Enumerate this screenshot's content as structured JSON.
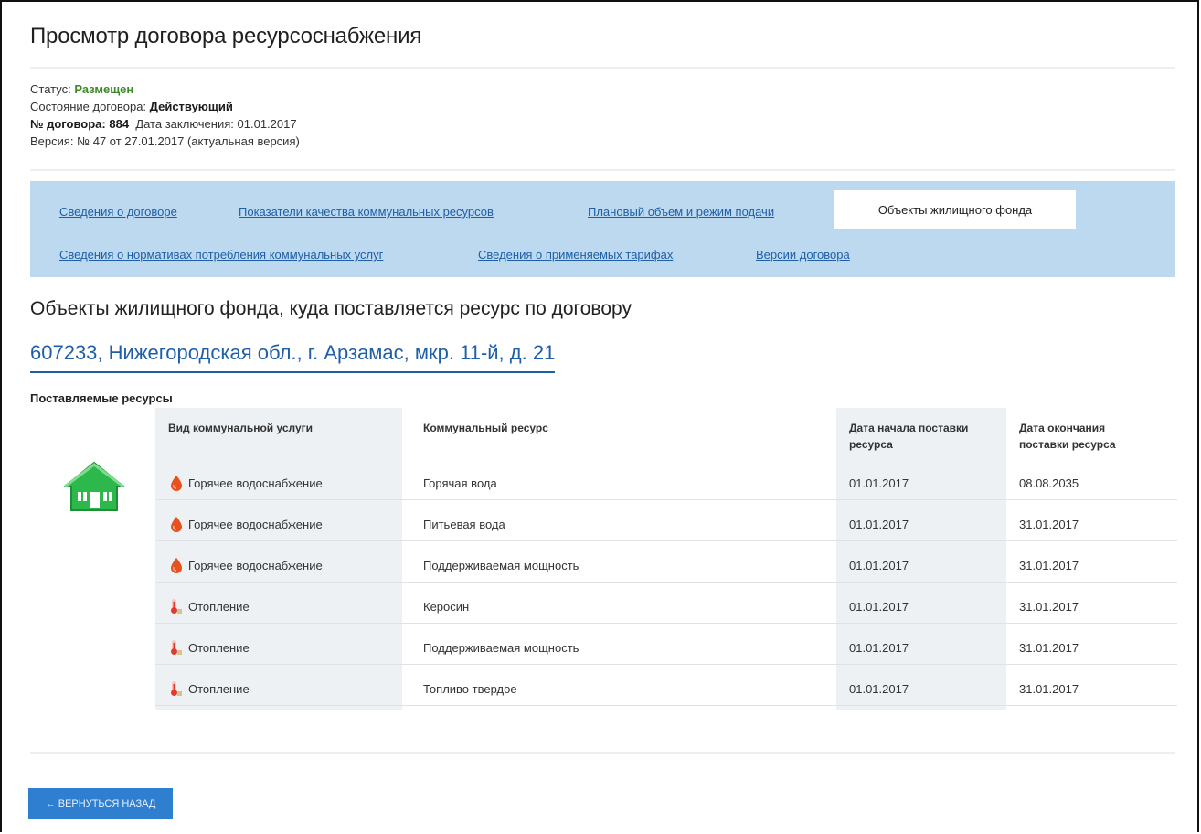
{
  "page": {
    "title": "Просмотр договора ресурсоснабжения"
  },
  "info": {
    "status_label": "Статус:",
    "status_value": "Размещен",
    "state_label": "Состояние договора:",
    "state_value": "Действующий",
    "number_label": "№ договора:",
    "number_value": "884",
    "date_label": "Дата заключения:",
    "date_value": "01.01.2017",
    "version_text": "Версия: № 47 от 27.01.2017 (актуальная версия)"
  },
  "tabs": {
    "row1": [
      {
        "label": "Сведения о договоре"
      },
      {
        "label": "Показатели качества коммунальных ресурсов"
      },
      {
        "label": "Плановый объем и режим подачи"
      }
    ],
    "active": "Объекты жилищного фонда",
    "row2": [
      {
        "label": "Сведения о нормативах потребления коммунальных услуг"
      },
      {
        "label": "Сведения о применяемых тарифах"
      },
      {
        "label": "Версии договора"
      }
    ]
  },
  "section": {
    "title": "Объекты жилищного фонда, куда поставляется ресурс по договору",
    "address": "607233, Нижегородская обл., г. Арзамас, мкр. 11-й, д. 21",
    "resources_heading": "Поставляемые ресурсы"
  },
  "table": {
    "headers": {
      "service": "Вид коммунальной услуги",
      "resource": "Коммунальный ресурс",
      "start": "Дата начала поставки ресурса",
      "end": "Дата окончания поставки ресурса"
    },
    "rows": [
      {
        "service": "Горячее водоснабжение",
        "icon": "hot-water-drop-icon",
        "resource": "Горячая вода",
        "start": "01.01.2017",
        "end": "08.08.2035"
      },
      {
        "service": "Горячее водоснабжение",
        "icon": "hot-water-drop-icon",
        "resource": "Питьевая вода",
        "start": "01.01.2017",
        "end": "31.01.2017"
      },
      {
        "service": "Горячее водоснабжение",
        "icon": "hot-water-drop-icon",
        "resource": "Поддерживаемая мощность",
        "start": "01.01.2017",
        "end": "31.01.2017"
      },
      {
        "service": "Отопление",
        "icon": "thermometer-icon",
        "resource": "Керосин",
        "start": "01.01.2017",
        "end": "31.01.2017"
      },
      {
        "service": "Отопление",
        "icon": "thermometer-icon",
        "resource": "Поддерживаемая мощность",
        "start": "01.01.2017",
        "end": "31.01.2017"
      },
      {
        "service": "Отопление",
        "icon": "thermometer-icon",
        "resource": "Топливо твердое",
        "start": "01.01.2017",
        "end": "31.01.2017"
      }
    ]
  },
  "footer": {
    "back_label": "← ВЕРНУТЬСЯ НАЗАД"
  },
  "colors": {
    "link": "#1f5fa8",
    "status_green": "#3b8a27",
    "tabs_bg": "#bcd9ef",
    "button": "#2f7fd1",
    "house_green": "#2db84b"
  }
}
